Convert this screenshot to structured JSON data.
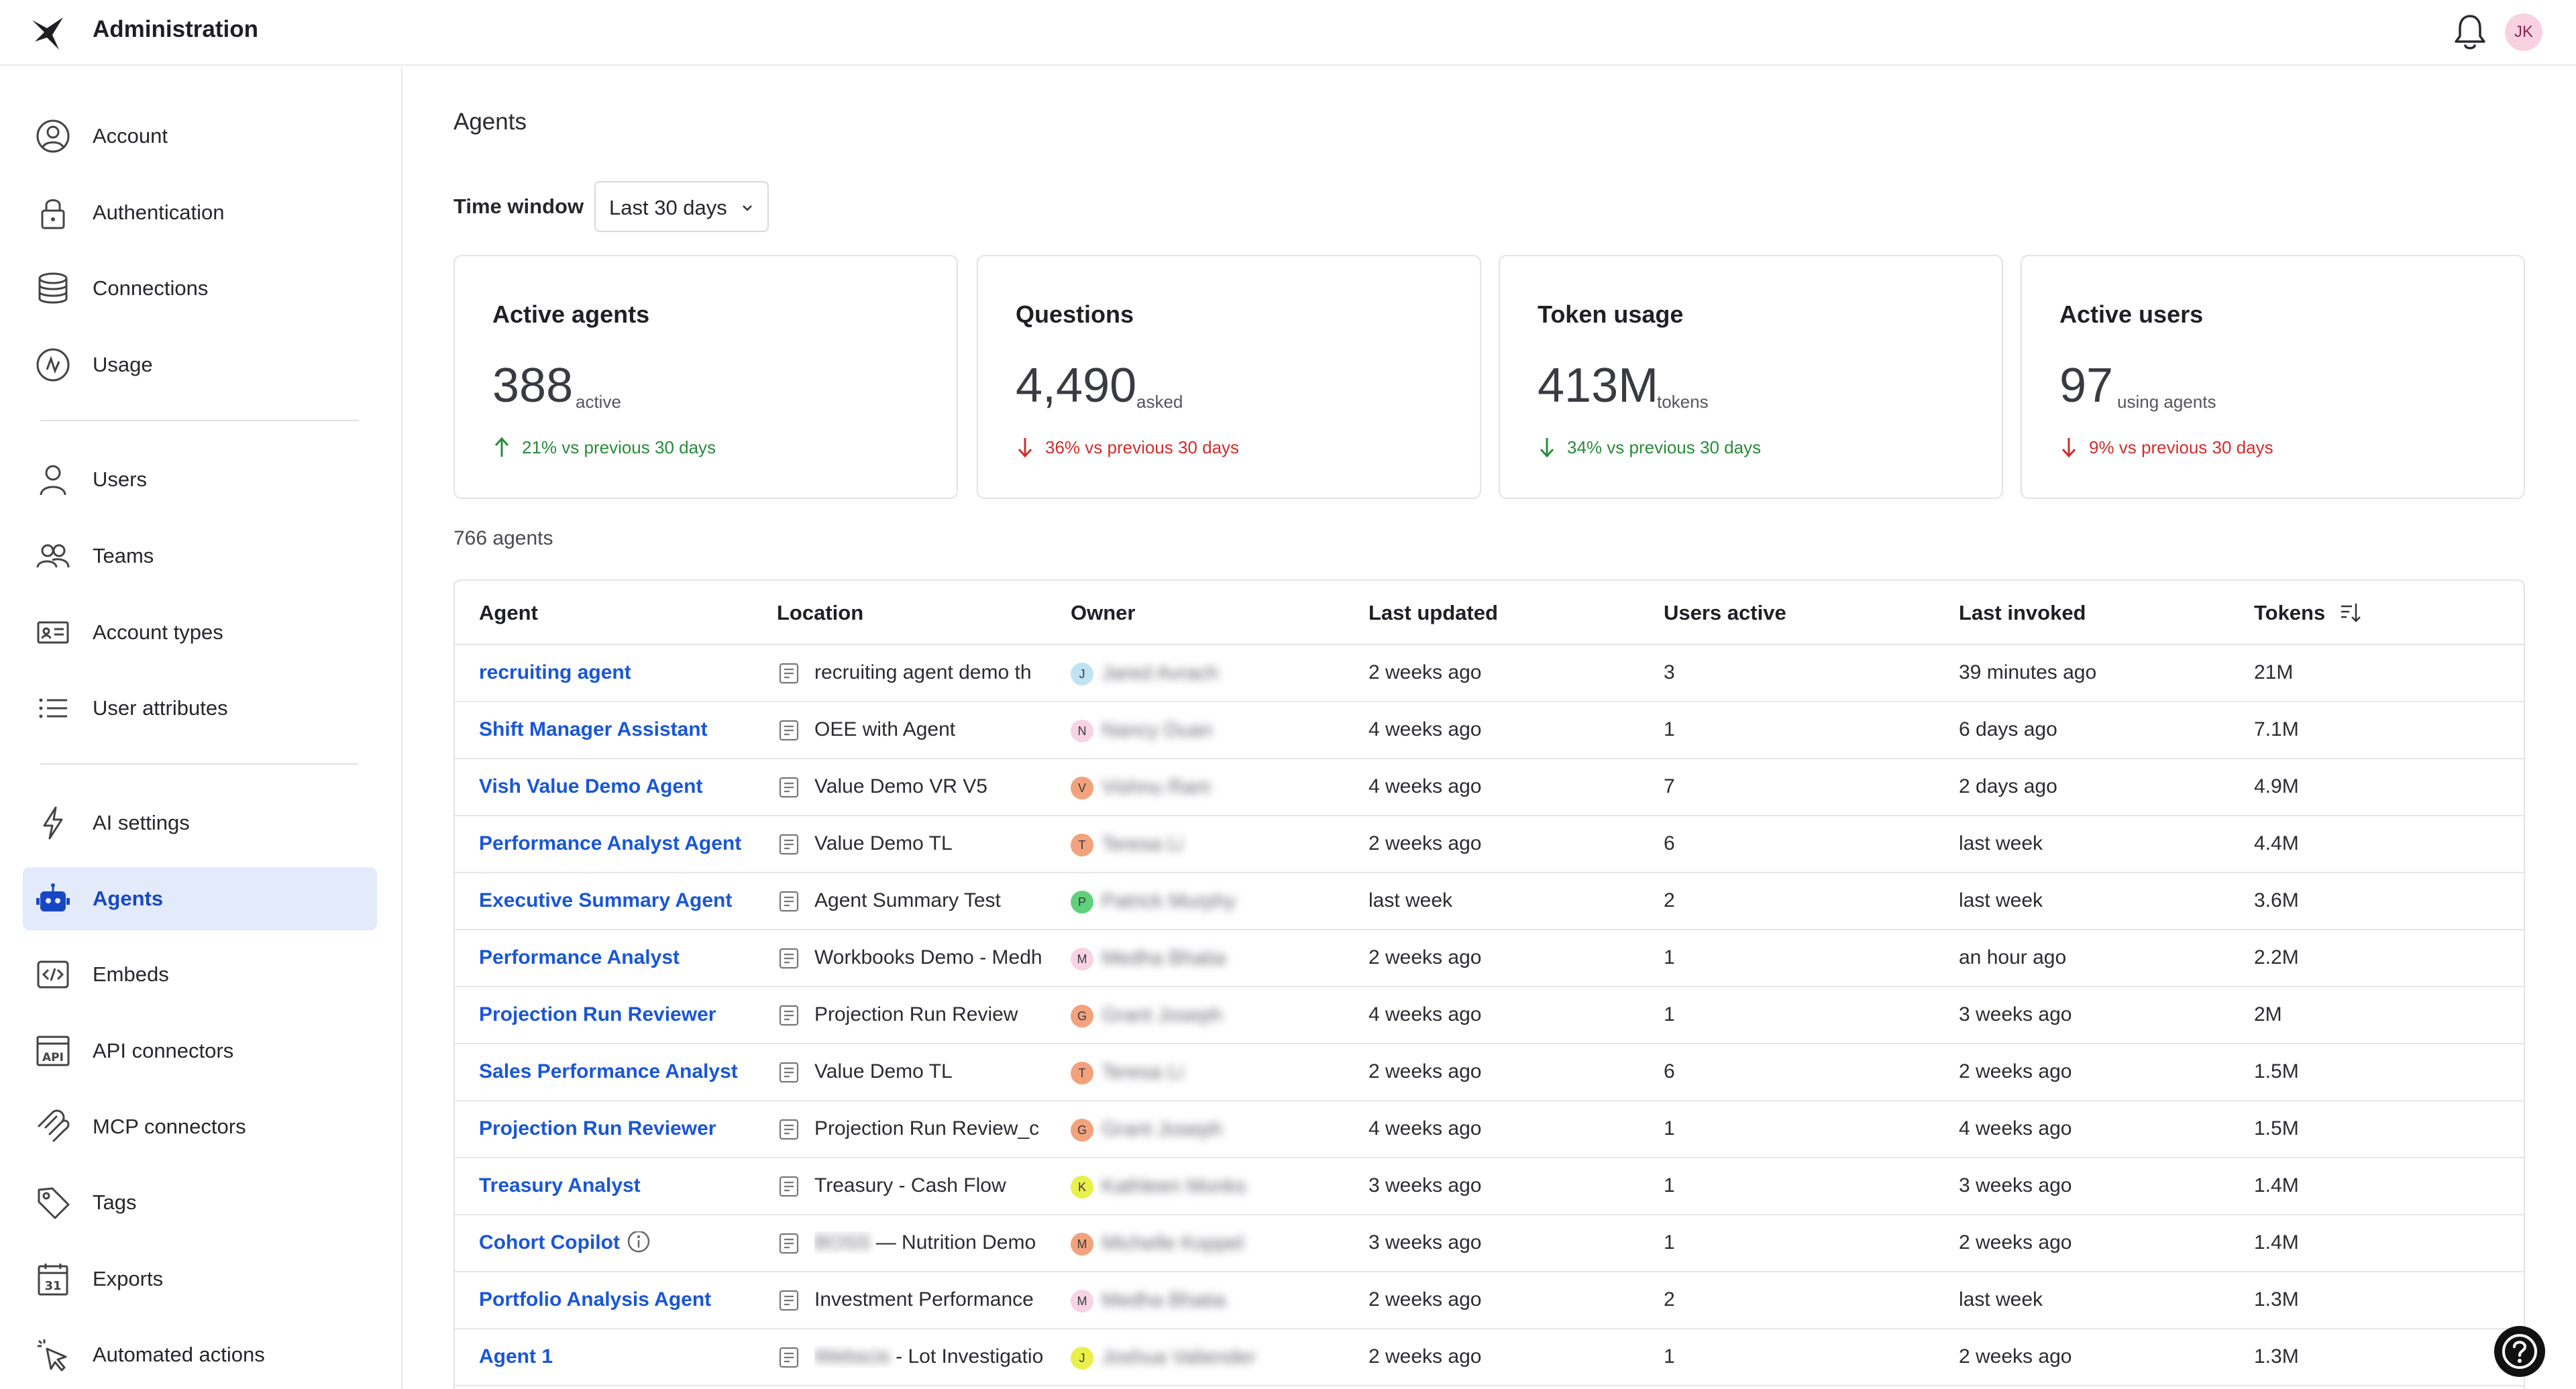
{
  "header": {
    "title": "Administration",
    "user_initials": "JK"
  },
  "sidebar": {
    "groups": [
      [
        {
          "label": "Account",
          "icon": "account-circle-icon"
        },
        {
          "label": "Authentication",
          "icon": "lock-icon"
        },
        {
          "label": "Connections",
          "icon": "database-icon"
        },
        {
          "label": "Usage",
          "icon": "usage-gauge-icon"
        }
      ],
      [
        {
          "label": "Users",
          "icon": "user-icon"
        },
        {
          "label": "Teams",
          "icon": "teams-icon"
        },
        {
          "label": "Account types",
          "icon": "id-card-icon"
        },
        {
          "label": "User attributes",
          "icon": "list-icon"
        }
      ],
      [
        {
          "label": "AI settings",
          "icon": "lightning-icon"
        },
        {
          "label": "Agents",
          "icon": "robot-icon",
          "active": true
        },
        {
          "label": "Embeds",
          "icon": "code-embed-icon"
        },
        {
          "label": "API connectors",
          "icon": "api-icon"
        },
        {
          "label": "MCP connectors",
          "icon": "mcp-icon"
        },
        {
          "label": "Tags",
          "icon": "tag-icon"
        },
        {
          "label": "Exports",
          "icon": "calendar-export-icon"
        },
        {
          "label": "Automated actions",
          "icon": "cursor-click-icon"
        }
      ]
    ]
  },
  "main": {
    "title": "Agents",
    "time_window": {
      "label": "Time window",
      "value": "Last 30 days"
    },
    "cards": [
      {
        "title": "Active agents",
        "value": "388",
        "unit": "active",
        "delta": "21% vs previous 30 days",
        "direction": "up",
        "tone": "green"
      },
      {
        "title": "Questions",
        "value": "4,490",
        "unit": "asked",
        "delta": "36% vs previous 30 days",
        "direction": "down",
        "tone": "red"
      },
      {
        "title": "Token usage",
        "value": "413M",
        "unit": "tokens",
        "delta": "34% vs previous 30 days",
        "direction": "down",
        "tone": "green"
      },
      {
        "title": "Active users",
        "value": "97",
        "unit": "using agents",
        "delta": "9% vs previous 30 days",
        "direction": "down",
        "tone": "red"
      }
    ],
    "agent_count": "766 agents",
    "table": {
      "columns": [
        "Agent",
        "Location",
        "Owner",
        "Last updated",
        "Users active",
        "Last invoked",
        "Tokens"
      ],
      "rows": [
        {
          "agent": "recruiting agent",
          "location": "recruiting agent demo th",
          "owner_initial": "J",
          "owner_color": "#bfe3f2",
          "owner": "Jared Avrach",
          "last_updated": "2 weeks ago",
          "users_active": "3",
          "last_invoked": "39 minutes ago",
          "tokens": "21M"
        },
        {
          "agent": "Shift Manager Assistant",
          "location": "OEE with Agent",
          "owner_initial": "N",
          "owner_color": "#f8d3e3",
          "owner": "Nancy Duan",
          "last_updated": "4 weeks ago",
          "users_active": "1",
          "last_invoked": "6 days ago",
          "tokens": "7.1M"
        },
        {
          "agent": "Vish Value Demo Agent",
          "location": "Value Demo VR V5",
          "owner_initial": "V",
          "owner_color": "#f2a27d",
          "owner": "Vishnu Ram",
          "last_updated": "4 weeks ago",
          "users_active": "7",
          "last_invoked": "2 days ago",
          "tokens": "4.9M"
        },
        {
          "agent": "Performance Analyst Agent",
          "location": "Value Demo TL",
          "owner_initial": "T",
          "owner_color": "#f2a27d",
          "owner": "Teresa Li",
          "last_updated": "2 weeks ago",
          "users_active": "6",
          "last_invoked": "last week",
          "tokens": "4.4M"
        },
        {
          "agent": "Executive Summary Agent",
          "location": "Agent Summary Test",
          "owner_initial": "P",
          "owner_color": "#5fd17a",
          "owner": "Patrick Murphy",
          "last_updated": "last week",
          "users_active": "2",
          "last_invoked": "last week",
          "tokens": "3.6M"
        },
        {
          "agent": "Performance Analyst",
          "location": "Workbooks Demo - Medh",
          "owner_initial": "M",
          "owner_color": "#f8d3e3",
          "owner": "Medha Bhatia",
          "last_updated": "2 weeks ago",
          "users_active": "1",
          "last_invoked": "an hour ago",
          "tokens": "2.2M"
        },
        {
          "agent": "Projection Run Reviewer",
          "location": "Projection Run Review",
          "owner_initial": "G",
          "owner_color": "#f2a27d",
          "owner": "Grant Joseph",
          "last_updated": "4 weeks ago",
          "users_active": "1",
          "last_invoked": "3 weeks ago",
          "tokens": "2M"
        },
        {
          "agent": "Sales Performance Analyst",
          "location": "Value Demo TL",
          "owner_initial": "T",
          "owner_color": "#f2a27d",
          "owner": "Teresa Li",
          "last_updated": "2 weeks ago",
          "users_active": "6",
          "last_invoked": "2 weeks ago",
          "tokens": "1.5M"
        },
        {
          "agent": "Projection Run Reviewer",
          "location": "Projection Run Review_c",
          "owner_initial": "G",
          "owner_color": "#f2a27d",
          "owner": "Grant Joseph",
          "last_updated": "4 weeks ago",
          "users_active": "1",
          "last_invoked": "4 weeks ago",
          "tokens": "1.5M"
        },
        {
          "agent": "Treasury Analyst",
          "location": "Treasury - Cash Flow",
          "owner_initial": "K",
          "owner_color": "#e9f04a",
          "owner": "Kathleen Monks",
          "last_updated": "3 weeks ago",
          "users_active": "1",
          "last_invoked": "3 weeks ago",
          "tokens": "1.4M"
        },
        {
          "agent": "Cohort Copilot",
          "location": "— Nutrition Demo",
          "location_prefix": "BOSS",
          "info": true,
          "owner_initial": "M",
          "owner_color": "#f2a27d",
          "owner": "Michelle Koppel",
          "last_updated": "3 weeks ago",
          "users_active": "1",
          "last_invoked": "2 weeks ago",
          "tokens": "1.4M"
        },
        {
          "agent": "Portfolio Analysis Agent",
          "location": "Investment Performance",
          "owner_initial": "M",
          "owner_color": "#f8d3e3",
          "owner": "Medha Bhatia",
          "last_updated": "2 weeks ago",
          "users_active": "2",
          "last_invoked": "last week",
          "tokens": "1.3M"
        },
        {
          "agent": "Agent 1",
          "location": "- Lot Investigatio",
          "location_prefix": "Webscis",
          "owner_initial": "J",
          "owner_color": "#e9f04a",
          "owner": "Joshua Valiender",
          "last_updated": "2 weeks ago",
          "users_active": "1",
          "last_invoked": "2 weeks ago",
          "tokens": "1.3M"
        }
      ]
    }
  },
  "colors": {
    "accent": "#1a56d6",
    "active_nav_bg": "#e3ebfb",
    "positive": "#2a8a3c",
    "negative": "#cf2d2d"
  }
}
